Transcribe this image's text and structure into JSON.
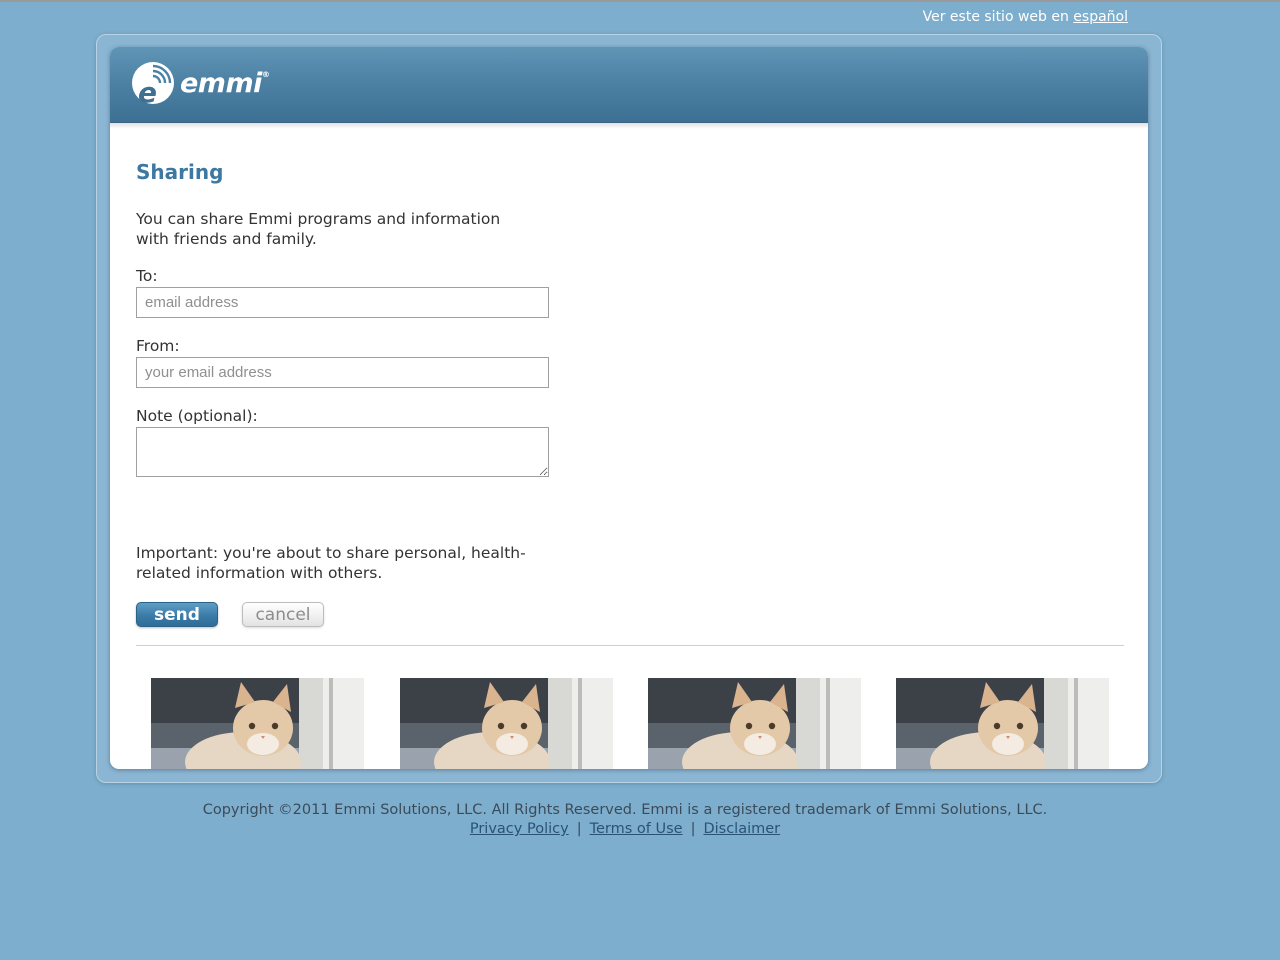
{
  "lang_bar": {
    "text": "Ver este sitio web en ",
    "link": "español"
  },
  "header": {
    "brand": "emmi",
    "brand_mark": "®"
  },
  "page": {
    "title": "Sharing",
    "intro": "You can share Emmi programs and information with friends and family."
  },
  "form": {
    "to_label": "To:",
    "to_placeholder": "email address",
    "from_label": "From:",
    "from_placeholder": "your email address",
    "note_label": "Note (optional):",
    "important": "Important: you're about to share personal, health-related information with others.",
    "send_label": "send",
    "cancel_label": "cancel"
  },
  "thumbnails": [
    {
      "icon": "kitten-photo"
    },
    {
      "icon": "kitten-photo"
    },
    {
      "icon": "kitten-photo"
    },
    {
      "icon": "kitten-photo"
    }
  ],
  "footer": {
    "copyright": "Copyright ©2011 Emmi Solutions, LLC. All Rights Reserved. Emmi is a registered trademark of Emmi Solutions, LLC.",
    "links": [
      "Privacy Policy",
      "Terms of Use",
      "Disclaimer"
    ],
    "separator": "|"
  },
  "colors": {
    "page_background": "#7eaecd",
    "header_blue": "#4d82a5",
    "title_blue": "#3c78a2"
  }
}
